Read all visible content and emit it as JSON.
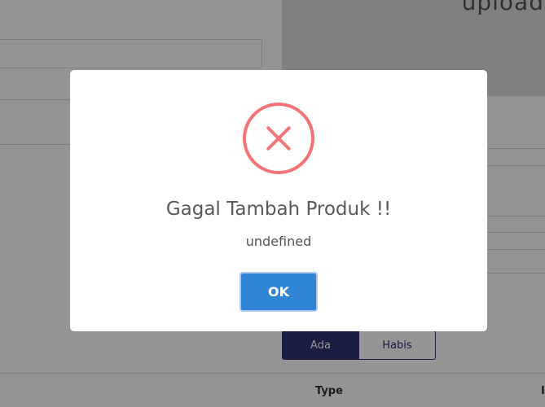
{
  "background": {
    "upload_title": "upload",
    "filter_tabs": [
      {
        "label": "Ada"
      },
      {
        "label": "Habis"
      }
    ],
    "table_headers": {
      "type": "Type",
      "edge": "I"
    }
  },
  "dialog": {
    "icon": "error-x-icon",
    "title": "Gagal Tambah Produk !!",
    "message": "undefined",
    "confirm_label": "OK"
  },
  "colors": {
    "error": "#f27474",
    "confirm": "#3085d6",
    "tab_active": "#2f3278"
  }
}
